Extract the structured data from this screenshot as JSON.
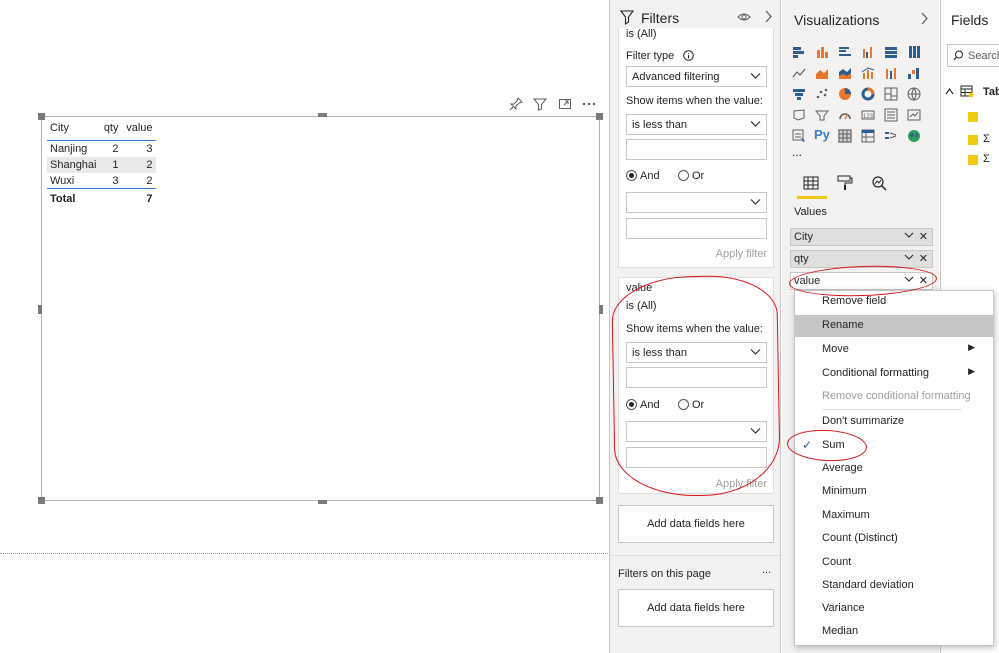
{
  "table_visual": {
    "columns": [
      "City",
      "qty",
      "value"
    ],
    "rows": [
      {
        "city": "Nanjing",
        "qty": "2",
        "value": "3"
      },
      {
        "city": "Shanghai",
        "qty": "1",
        "value": "2"
      },
      {
        "city": "Wuxi",
        "qty": "3",
        "value": "2"
      }
    ],
    "total": {
      "label": "Total",
      "value": "7"
    },
    "header_icons": [
      "pin-icon",
      "filter-icon",
      "focus-mode-icon",
      "more-options-icon"
    ]
  },
  "filters": {
    "title": "Filters",
    "card1": {
      "state": "is (All)",
      "filter_type_label": "Filter type",
      "filter_type_value": "Advanced filtering",
      "show_items_label": "Show items when the value:",
      "condition1": "is less than",
      "and_label": "And",
      "or_label": "Or",
      "apply_label": "Apply filter"
    },
    "card2": {
      "field": "value",
      "state": "is (All)",
      "show_items_label": "Show items when the value:",
      "condition1": "is less than",
      "and_label": "And",
      "or_label": "Or",
      "apply_label": "Apply filter"
    },
    "add_fields_visual": "Add data fields here",
    "page_section_label": "Filters on this page",
    "page_more": "...",
    "add_fields_page": "Add data fields here"
  },
  "visualizations": {
    "title": "Visualizations",
    "more": "...",
    "values_label": "Values",
    "wells": [
      "City",
      "qty",
      "value"
    ]
  },
  "fields": {
    "title": "Fields",
    "search_placeholder": "Search",
    "table_name": "Table",
    "sigma": "Σ"
  },
  "context_menu": {
    "items": [
      {
        "label": "Remove field",
        "state": "normal"
      },
      {
        "label": "Rename",
        "state": "highlighted"
      },
      {
        "label": "Move",
        "state": "submenu"
      },
      {
        "label": "Conditional formatting",
        "state": "submenu"
      },
      {
        "label": "Remove conditional formatting",
        "state": "disabled"
      },
      {
        "label": "Don't summarize",
        "state": "normal"
      },
      {
        "label": "Sum",
        "state": "checked"
      },
      {
        "label": "Average",
        "state": "normal"
      },
      {
        "label": "Minimum",
        "state": "normal"
      },
      {
        "label": "Maximum",
        "state": "normal"
      },
      {
        "label": "Count (Distinct)",
        "state": "normal"
      },
      {
        "label": "Count",
        "state": "normal"
      },
      {
        "label": "Standard deviation",
        "state": "normal"
      },
      {
        "label": "Variance",
        "state": "normal"
      },
      {
        "label": "Median",
        "state": "normal"
      }
    ]
  },
  "colors": {
    "accent_blue": "#3a7ed0",
    "annotation_red": "#d7141c",
    "checkbox_yellow": "#f2c811",
    "pane_background": "#f3f2f1"
  }
}
